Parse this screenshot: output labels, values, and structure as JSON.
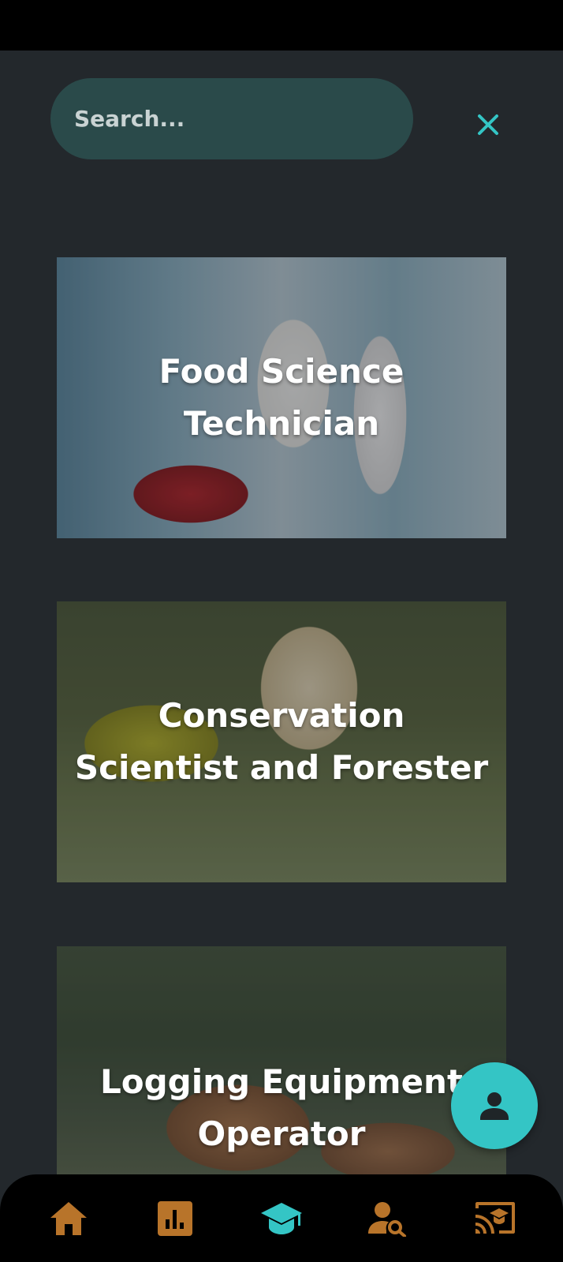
{
  "search": {
    "placeholder": "Search..."
  },
  "careers": [
    {
      "title": "Food Science Technician"
    },
    {
      "title": "Conservation Scientist and Forester"
    },
    {
      "title": "Logging Equipment Operator"
    }
  ],
  "bottom_nav": [
    {
      "icon": "home-icon",
      "active": false
    },
    {
      "icon": "bar-chart-icon",
      "active": false
    },
    {
      "icon": "graduation-cap-icon",
      "active": true
    },
    {
      "icon": "person-search-icon",
      "active": false
    },
    {
      "icon": "cast-for-education-icon",
      "active": false
    }
  ],
  "colors": {
    "accent": "#34c5c5",
    "nav_inactive": "#b8742a",
    "background": "#23282c",
    "search_bg": "#2a4a4a"
  }
}
